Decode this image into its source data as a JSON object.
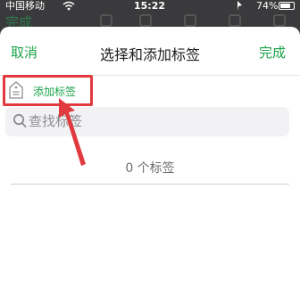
{
  "status_bar": {
    "carrier": "中国移动",
    "time": "15:22",
    "battery": "74%"
  },
  "background": {
    "done_label": "完成"
  },
  "sheet": {
    "cancel_label": "取消",
    "title": "选择和添加标签",
    "done_label": "完成",
    "add_tag_label": "添加标签",
    "search": {
      "placeholder": "查找标签",
      "value": ""
    },
    "count_text": "0 个标签"
  },
  "annotation": {
    "color": "#e0393e"
  },
  "colors": {
    "accent": "#1aa34a"
  },
  "icons": [
    "wifi-icon",
    "location-icon",
    "battery-icon",
    "tag-icon",
    "search-icon",
    "arrow-annotation"
  ]
}
